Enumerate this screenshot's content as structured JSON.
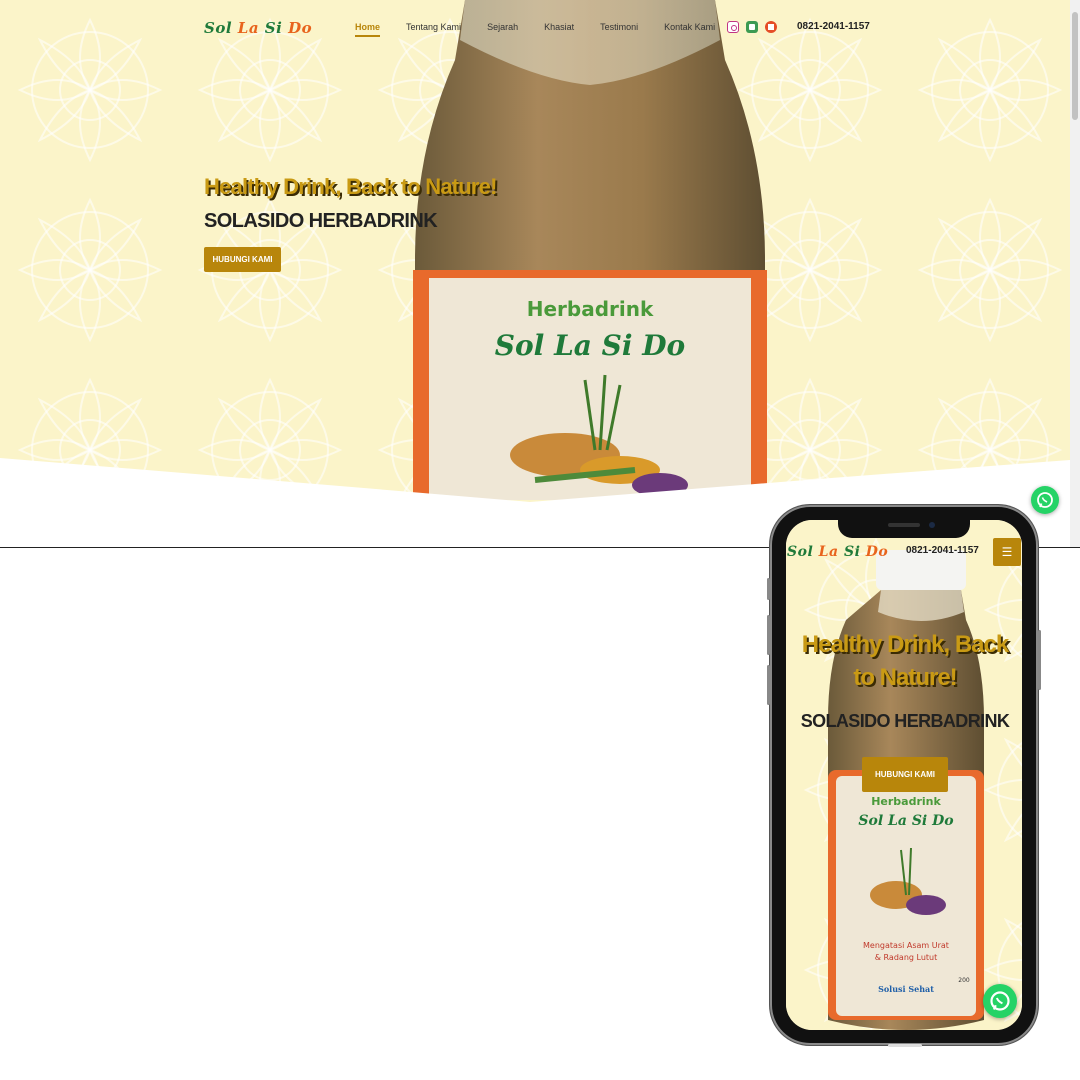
{
  "brand": {
    "logo_parts": [
      "Sol",
      "La",
      "Si",
      "Do"
    ],
    "label_brand": "Herbadrink",
    "label_benefit_1": "Mengatasi Asam Urat",
    "label_benefit_2": "& Radang Lutut",
    "label_maker": "Solusi Sehat",
    "label_volume": "200"
  },
  "nav": {
    "items": [
      "Home",
      "Tentang Kami",
      "Sejarah",
      "Khasiat",
      "Testimoni",
      "Kontak Kami"
    ],
    "active": "Home",
    "social_icons": [
      "instagram-icon",
      "shop-icon",
      "marketplace-icon"
    ],
    "phone": "0821-2041-1157"
  },
  "hero": {
    "tagline": "Healthy Drink, Back to Nature!",
    "subtitle": "SOLASIDO HERBADRINK",
    "cta": "HUBUNGI KAMI"
  },
  "mobile": {
    "phone": "0821-2041-1157",
    "menu_icon": "hamburger-icon",
    "tagline": "Healthy Drink, Back to Nature!",
    "subtitle": "SOLASIDO HERBADRINK",
    "cta": "HUBUNGI KAMI"
  },
  "floating": {
    "whatsapp_icon": "whatsapp-icon"
  },
  "colors": {
    "accent": "#b8860b",
    "hero_bg": "#fbf4c9",
    "tagline": "#c99a14",
    "logo_green": "#1f7a3a",
    "logo_orange": "#e8631c",
    "whatsapp": "#25d366"
  }
}
